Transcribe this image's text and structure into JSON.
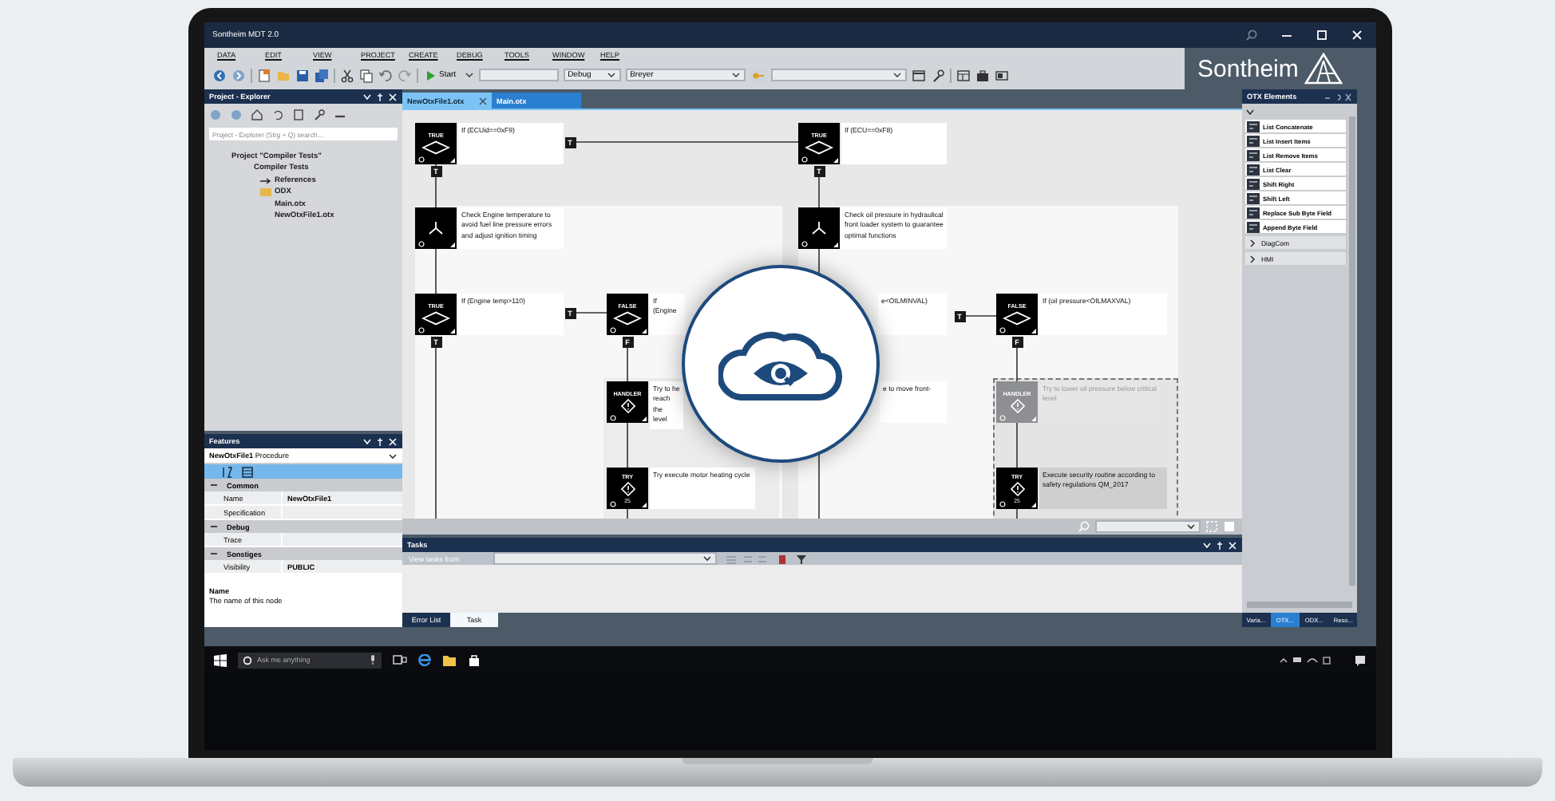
{
  "window": {
    "title": "Sontheim MDT 2.0"
  },
  "menu": [
    "DATA",
    "EDIT",
    "VIEW",
    "PROJECT",
    "CREATE",
    "DEBUG",
    "TOOLS",
    "WINDOW",
    "HELP"
  ],
  "toolbar": {
    "run_button": "Start",
    "configuration": "Debug",
    "target": "Breyer"
  },
  "logo": {
    "text": "Sontheim"
  },
  "explorer": {
    "title": "Project - Explorer",
    "search": {
      "placeholder": "Project - Explorer (Strg + Q) search..."
    },
    "tree": [
      {
        "label": "Project \"Compiler Tests\"",
        "kind": "project",
        "children": [
          {
            "label": "Compiler Tests",
            "kind": "project",
            "children": [
              {
                "label": "References",
                "kind": "reference"
              },
              {
                "label": "ODX",
                "kind": "folder"
              },
              {
                "label": "Main.otx",
                "kind": "file"
              },
              {
                "label": "NewOtxFile1.otx",
                "kind": "file"
              }
            ]
          }
        ]
      }
    ]
  },
  "features": {
    "title": "Features",
    "object": {
      "name": "NewOtxFile1",
      "type": "Procedure"
    },
    "sections": [
      {
        "title": "Common",
        "expanded": true,
        "rows": [
          {
            "name": "Name",
            "value": "NewOtxFile1"
          },
          {
            "name": "Specification"
          }
        ]
      },
      {
        "title": "Debug",
        "expanded": true,
        "rows": [
          {
            "name": "Trace"
          }
        ]
      },
      {
        "title": "Sonstiges",
        "expanded": true,
        "rows": [
          {
            "name": "Visibility",
            "value": "PUBLIC"
          }
        ]
      }
    ],
    "description": {
      "title": "Name",
      "text": "The name of this node"
    }
  },
  "editor_tabs": [
    {
      "label": "NewOtxFile1.otx",
      "selected": true
    },
    {
      "label": "Main.otx",
      "selected": false
    }
  ],
  "canvas": {
    "nodes": [
      {
        "kind": "condition",
        "label": "TRUE",
        "text": "If (ECUid==0xF9)",
        "disabled": false,
        "selected": false
      },
      {
        "kind": "condition",
        "label": "TRUE",
        "text": "If (ECU==0xF8)",
        "disabled": false,
        "selected": false
      },
      {
        "kind": "action",
        "text": "Check Engine temperature to avoid fuel line pressure errors and adjust ignition timing",
        "disabled": false,
        "selected": false
      },
      {
        "kind": "action",
        "text": "Check oil pressure in hydraulical front loader system to guarantee optimal functions",
        "disabled": false,
        "selected": false
      },
      {
        "kind": "condition",
        "label": "TRUE",
        "text": "If (Engine temp>110)",
        "disabled": false,
        "selected": false
      },
      {
        "kind": "condition",
        "label": "FALSE",
        "text": "If  (Engine",
        "disabled": false,
        "selected": false
      },
      {
        "kind": "partial",
        "text": "e<OILMINVAL)",
        "disabled": false,
        "selected": false
      },
      {
        "kind": "condition",
        "label": "FALSE",
        "text": "If (oil pressure<OILMAXVAL)",
        "disabled": false,
        "selected": false
      },
      {
        "kind": "handler",
        "label": "HANDLER",
        "text": "Try to he\nreach the\nlevel",
        "disabled": false,
        "selected": false
      },
      {
        "kind": "partial",
        "text": "e to move front-",
        "disabled": false,
        "selected": false
      },
      {
        "kind": "handler",
        "label": "HANDLER",
        "text": "Try to lower oil pressure below critical level",
        "disabled": true,
        "selected": false
      },
      {
        "kind": "try",
        "label": "TRY",
        "count": "25",
        "text": "Try execute motor heating cycle",
        "disabled": false,
        "selected": false
      },
      {
        "kind": "try",
        "label": "TRY",
        "count": "25",
        "text": "Execute security routine according to safety regulations QM_2017",
        "disabled": false,
        "selected": true
      }
    ],
    "ports": [
      {
        "label": "T"
      },
      {
        "label": "T"
      },
      {
        "label": "T"
      },
      {
        "label": "T"
      },
      {
        "label": "T"
      },
      {
        "label": "F"
      },
      {
        "label": "T"
      },
      {
        "label": "F"
      }
    ]
  },
  "tasks": {
    "title": "Tasks",
    "filter_label": "View tasks from",
    "tabs": [
      {
        "label": "Error List",
        "selected": false
      },
      {
        "label": "Task",
        "selected": true
      }
    ]
  },
  "otx_elements": {
    "title": "OTX Elements",
    "items": [
      "List Concatenate",
      "List Insert Items",
      "List Remove Items",
      "List Clear",
      "Shift Right",
      "Shift Left",
      "Replace Sub Byte Field",
      "Append Byte Field"
    ],
    "groups": [
      {
        "label": "DiagCom",
        "expanded": false
      },
      {
        "label": "HMI",
        "expanded": false
      }
    ],
    "tabs": [
      {
        "label": "Varia...",
        "selected": false
      },
      {
        "label": "OTX...",
        "selected": true
      },
      {
        "label": "ODX...",
        "selected": false
      },
      {
        "label": "Reso...",
        "selected": false
      }
    ]
  },
  "taskbar": {
    "search": {
      "placeholder": "Ask me anything"
    }
  }
}
